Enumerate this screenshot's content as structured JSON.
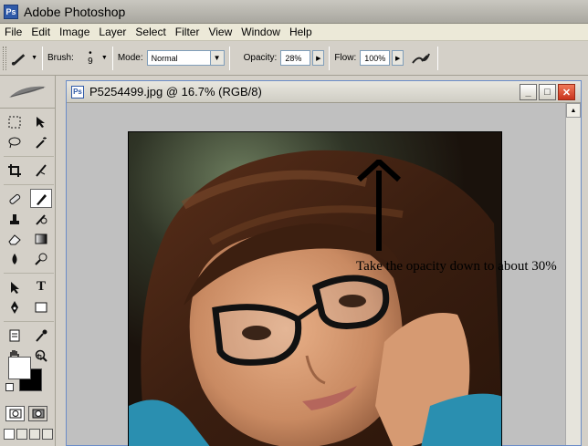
{
  "app": {
    "title": "Adobe Photoshop",
    "icon": "photoshop-icon"
  },
  "menu": [
    "File",
    "Edit",
    "Image",
    "Layer",
    "Select",
    "Filter",
    "View",
    "Window",
    "Help"
  ],
  "options": {
    "brush_label": "Brush:",
    "brush_size": "9",
    "mode_label": "Mode:",
    "mode_value": "Normal",
    "opacity_label": "Opacity:",
    "opacity_value": "28%",
    "flow_label": "Flow:",
    "flow_value": "100%"
  },
  "document": {
    "title": "P5254499.jpg @ 16.7% (RGB/8)"
  },
  "annotation": {
    "text": "Take the opacity down to about 30%"
  },
  "colors": {
    "foreground": "#ffffff",
    "background": "#000000",
    "accent": "#6a8cc8"
  }
}
